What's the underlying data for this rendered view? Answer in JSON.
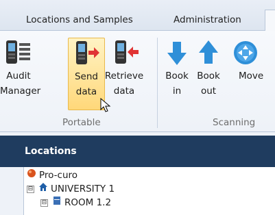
{
  "tabs": [
    {
      "label": "Locations and Samples"
    },
    {
      "label": "Administration"
    }
  ],
  "ribbon": {
    "buttons": [
      {
        "line1": "Audit",
        "line2": "Manager",
        "icon": "handheld-list-icon"
      },
      {
        "line1": "Send",
        "line2": "data",
        "icon": "handheld-send-icon"
      },
      {
        "line1": "Retrieve",
        "line2": "data",
        "icon": "handheld-retrieve-icon"
      },
      {
        "line1": "Book",
        "line2": "in",
        "icon": "arrow-down-icon"
      },
      {
        "line1": "Book",
        "line2": "out",
        "icon": "arrow-up-icon"
      },
      {
        "line1": "Move",
        "line2": "",
        "icon": "move-icon"
      }
    ],
    "groups": [
      {
        "label": "Portable"
      },
      {
        "label": "Scanning"
      }
    ]
  },
  "panel": {
    "title": "Locations",
    "tree": [
      {
        "label": "Pro-curo",
        "icon": "orb-icon"
      },
      {
        "label": "UNIVERSITY 1",
        "icon": "home-icon",
        "expander": "⊟"
      },
      {
        "label": "ROOM 1.2",
        "icon": "freezer-icon",
        "expander": "⊟"
      }
    ]
  },
  "colors": {
    "panel_header": "#1f3c5f",
    "highlight": "#ffd87a",
    "arrow_blue": "#2f8fd8",
    "arrow_red": "#e03434"
  }
}
